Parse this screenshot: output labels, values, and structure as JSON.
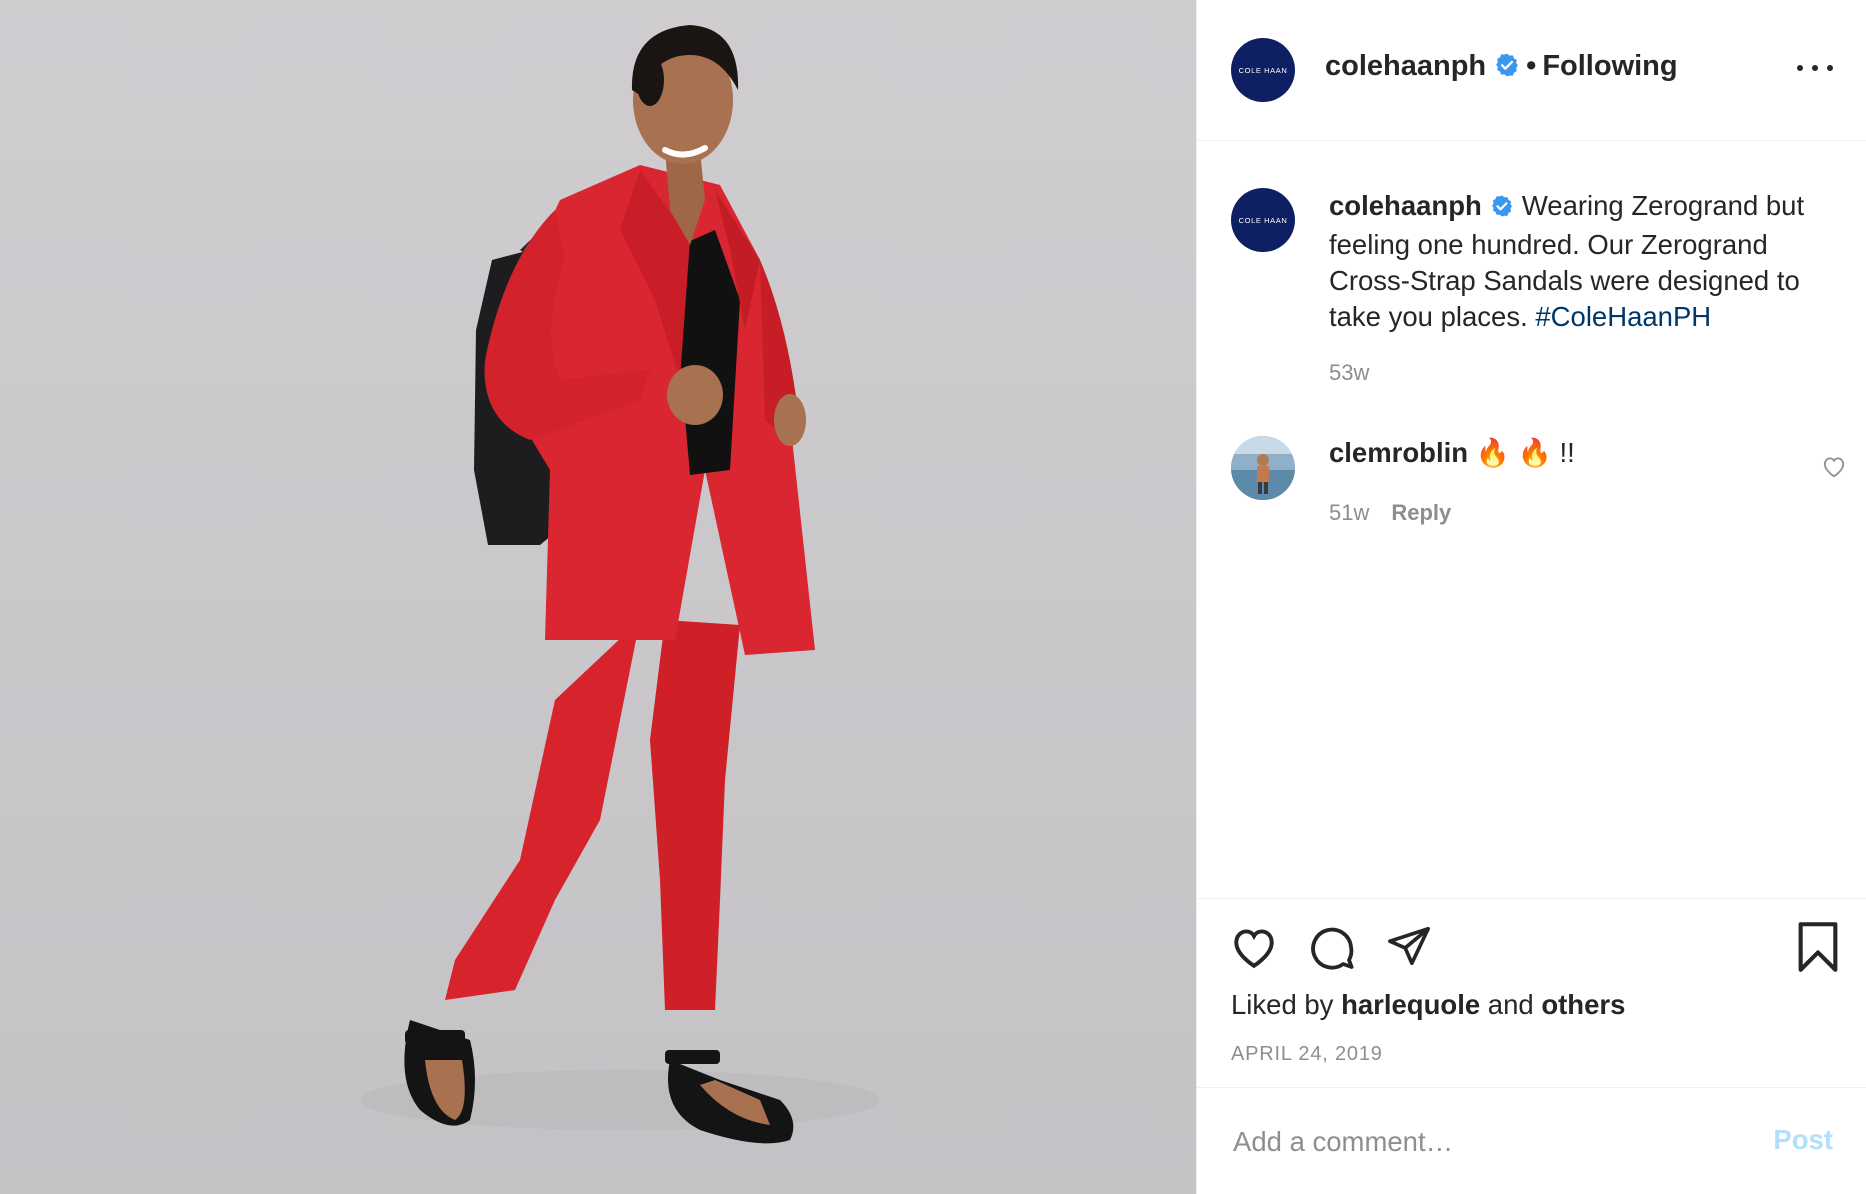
{
  "post": {
    "username": "colehaanph",
    "follow_status": "Following",
    "separator": "•",
    "brand_avatar_text": "COLE HAAN",
    "caption_text": "Wearing Zerogrand but feeling one hundred. Our Zerogrand Cross-Strap Sandals were designed to take you places.",
    "hashtag": "#ColeHaanPH",
    "caption_age": "53w"
  },
  "comments": [
    {
      "username": "clemroblin",
      "text": "🔥 🔥 !!",
      "age": "51w",
      "reply_label": "Reply"
    }
  ],
  "likes": {
    "prefix": "Liked by",
    "user": "harlequole",
    "middle": "and",
    "suffix": "others"
  },
  "date": "APRIL 24, 2019",
  "comment_box": {
    "placeholder": "Add a comment…",
    "post_label": "Post"
  },
  "icons": {
    "verified": "verified-badge-icon",
    "more": "more-options-icon",
    "like": "heart-icon",
    "comment": "comment-bubble-icon",
    "share": "paper-plane-icon",
    "save": "bookmark-icon"
  },
  "colors": {
    "brand_avatar": "#0f1f63",
    "verified": "#3897f0",
    "hashtag": "#00376b",
    "post_button_disabled": "#b2dffc",
    "muted_text": "#8e8e8e"
  }
}
